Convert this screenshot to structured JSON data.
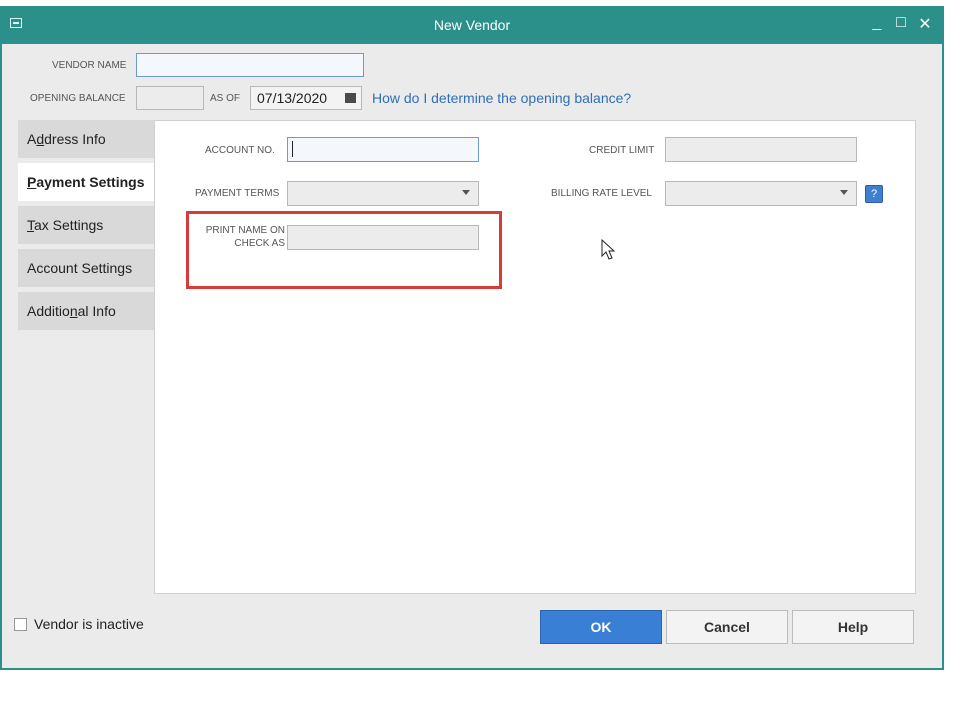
{
  "window": {
    "title": "New Vendor",
    "minimize": "_",
    "maximize": "□",
    "close": "✕"
  },
  "header": {
    "vendor_name_label": "VENDOR NAME",
    "vendor_name_value": "",
    "opening_balance_label": "OPENING BALANCE",
    "opening_balance_value": "",
    "as_of_label": "AS OF",
    "as_of_date": "07/13/2020",
    "help_link": "How do I determine the opening balance?"
  },
  "tabs": [
    {
      "label": "Address Info",
      "pre": "A",
      "mn": "d",
      "post": "dress Info",
      "active": false
    },
    {
      "label": "Payment Settings",
      "pre": "",
      "mn": "P",
      "post": "ayment Settings",
      "active": true
    },
    {
      "label": "Tax Settings",
      "pre": "",
      "mn": "T",
      "post": "ax Settings",
      "active": false
    },
    {
      "label": "Account Settings",
      "pre": "Account Settin",
      "mn": "g",
      "post": "s",
      "active": false
    },
    {
      "label": "Additional Info",
      "pre": "Additio",
      "mn": "n",
      "post": "al Info",
      "active": false
    }
  ],
  "payment": {
    "account_no_label": "ACCOUNT NO.",
    "account_no_value": "",
    "payment_terms_label": "PAYMENT TERMS",
    "payment_terms_value": "",
    "print_name_label_1": "PRINT NAME ON",
    "print_name_label_2": "CHECK AS",
    "print_name_value": "",
    "credit_limit_label": "CREDIT LIMIT",
    "credit_limit_value": "",
    "billing_rate_label": "BILLING RATE LEVEL",
    "billing_rate_value": "",
    "billing_help": "?"
  },
  "footer": {
    "inactive_label": "Vendor is inactive",
    "inactive_checked": false,
    "ok_label": "OK",
    "cancel_label": "Cancel",
    "help_label": "Help"
  },
  "colors": {
    "titlebar": "#2b8f8a",
    "primary_button": "#3a7fd6",
    "highlight": "#d83b3b",
    "link": "#2e6fb7"
  },
  "icons": [
    "system-menu-icon",
    "minimize-icon",
    "maximize-icon",
    "close-icon",
    "calendar-icon",
    "dropdown-caret-icon",
    "help-icon",
    "mouse-cursor-icon"
  ]
}
